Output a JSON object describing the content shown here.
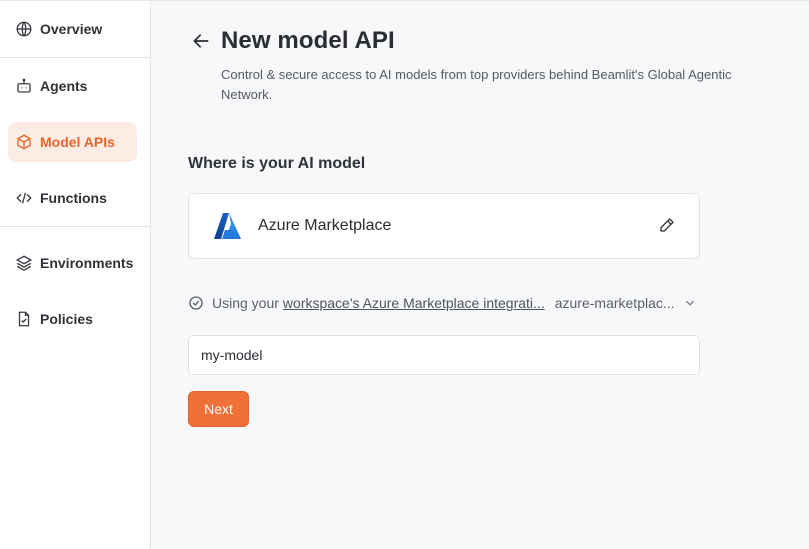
{
  "sidebar": {
    "items": [
      {
        "label": "Overview",
        "icon": "globe-icon"
      },
      {
        "label": "Agents",
        "icon": "robot-icon"
      },
      {
        "label": "Model APIs",
        "icon": "cube-icon",
        "active": true
      },
      {
        "label": "Functions",
        "icon": "code-icon"
      },
      {
        "label": "Environments",
        "icon": "layers-icon"
      },
      {
        "label": "Policies",
        "icon": "file-check-icon"
      }
    ]
  },
  "header": {
    "title": "New model API",
    "subtitle": "Control & secure access to AI models from top providers behind Beamlit's Global Agentic Network."
  },
  "form": {
    "section_title": "Where is your AI model",
    "provider": {
      "name": "Azure Marketplace",
      "logo": "azure-logo"
    },
    "integration": {
      "prefix": "Using your",
      "link_text": "workspace's Azure Marketplace integrati...",
      "selected": "azure-marketplac..."
    },
    "model_name": {
      "value": "my-model",
      "placeholder": ""
    },
    "next_label": "Next"
  },
  "colors": {
    "accent": "#f07037",
    "active_bg": "#fdece3",
    "active_text": "#e8652e"
  }
}
